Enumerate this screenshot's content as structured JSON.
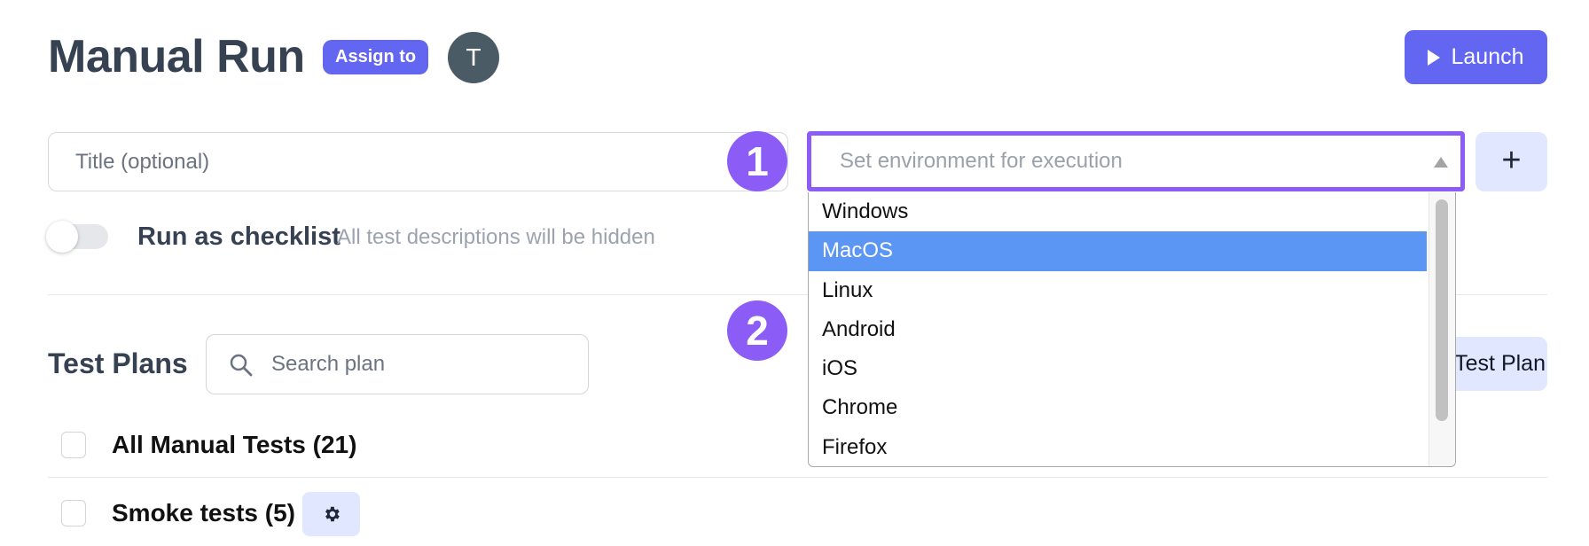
{
  "header": {
    "title": "Manual Run",
    "assign_label": "Assign to",
    "avatar_initial": "T",
    "launch_label": "Launch"
  },
  "form": {
    "title_placeholder": "Title (optional)",
    "environment_placeholder": "Set environment for execution",
    "environment_options": [
      "Windows",
      "MacOS",
      "Linux",
      "Android",
      "iOS",
      "Chrome",
      "Firefox"
    ],
    "environment_highlighted": "MacOS",
    "add_environment_label": "+",
    "checklist_label": "Run as checklist",
    "checklist_hint": "All test descriptions will be hidden",
    "checklist_enabled": false
  },
  "annotations": [
    "1",
    "2"
  ],
  "test_plans": {
    "title": "Test Plans",
    "search_placeholder": "Search plan",
    "new_plan_label": "Test Plan",
    "rows": [
      {
        "label": "All Manual Tests (21)",
        "checked": false,
        "has_settings": false
      },
      {
        "label": "Smoke tests (5)",
        "checked": false,
        "has_settings": true
      }
    ]
  },
  "colors": {
    "primary": "#6366f1",
    "annotation": "#8b5cf6",
    "highlight": "#5b96f5",
    "soft_button": "#e0e7ff"
  }
}
